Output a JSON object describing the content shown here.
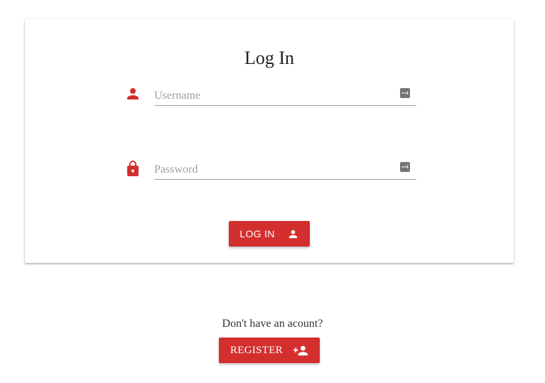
{
  "login_card": {
    "title": "Log In",
    "username": {
      "placeholder": "Username",
      "value": "",
      "icon": "person-icon",
      "trailing_icon": "password-manager-icon"
    },
    "password": {
      "placeholder": "Password",
      "value": "",
      "icon": "lock-icon",
      "trailing_icon": "password-manager-icon"
    },
    "login_button": {
      "label": "LOG IN",
      "icon": "person-icon"
    }
  },
  "register_section": {
    "prompt": "Don't have an acount?",
    "register_button": {
      "label": "REGISTER",
      "icon": "person-add-icon"
    }
  },
  "colors": {
    "accent": "#d32f2f",
    "text": "#333333",
    "placeholder": "#9e9e9e",
    "underline": "#9e9e9e",
    "background": "#ffffff"
  }
}
